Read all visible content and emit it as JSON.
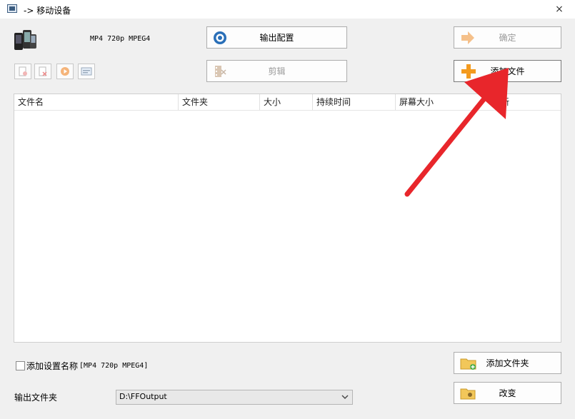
{
  "window": {
    "title": "-> 移动设备",
    "close": "×"
  },
  "header": {
    "profile_text": "MP4 720p MPEG4"
  },
  "toolbar": {
    "output_config": "输出配置",
    "clip": "剪辑",
    "ok": "确定",
    "add_file": "添加文件"
  },
  "file_list": {
    "columns": [
      "文件名",
      "文件夹",
      "大小",
      "持续时间",
      "屏幕大小",
      "新"
    ]
  },
  "footer": {
    "add_setting_label": "添加设置名称",
    "add_setting_value": "[MP4 720p MPEG4]",
    "add_folder": "添加文件夹",
    "output_folder_label": "输出文件夹",
    "output_folder_value": "D:\\FFOutput",
    "change": "改变"
  },
  "colors": {
    "arrow": "#e8262b",
    "add_icon": "#f39a1e"
  }
}
